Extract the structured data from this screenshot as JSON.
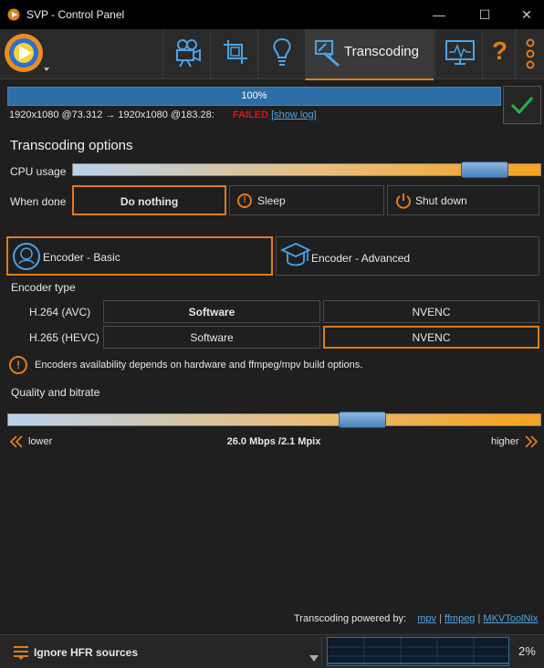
{
  "window": {
    "title": "SVP - Control Panel"
  },
  "toolbar": {
    "active_tab_label": "Transcoding",
    "help_glyph": "?"
  },
  "progress": {
    "percent_label": "100%",
    "value": 1.0
  },
  "status": {
    "text": "1920x1080 @73.312 → 1920x1080 @183.28:",
    "failed": "FAILED",
    "bracket_open": "[",
    "show_log": "show log",
    "bracket_close": "]"
  },
  "transcoding": {
    "heading": "Transcoding options",
    "cpu_usage_label": "CPU usage",
    "cpu_usage_value": 0.92,
    "when_done_label": "When done",
    "when_done": {
      "do_nothing": "Do nothing",
      "sleep": "Sleep",
      "shut_down": "Shut down"
    }
  },
  "encoder": {
    "basic_tab": "Encoder - Basic",
    "advanced_tab": "Encoder - Advanced",
    "type_label": "Encoder type",
    "h264_label": "H.264 (AVC)",
    "h265_label": "H.265 (HEVC)",
    "software": "Software",
    "nvenc": "NVENC",
    "info_text": "Encoders availability depends on hardware and ffmpeg/mpv build options."
  },
  "quality": {
    "label": "Quality and bitrate",
    "value": 0.68,
    "lower": "lower",
    "higher": "higher",
    "bitrate_text": "26.0 Mbps /2.1 Mpix"
  },
  "powered": {
    "label": "Transcoding powered by:",
    "mpv": "mpv",
    "ffmpeg": "ffmpeg",
    "mkvtoolnix": "MKVToolNix",
    "sep": "|"
  },
  "footer": {
    "profile_label": "Ignore HFR sources",
    "cpu_percent": "2%"
  },
  "colors": {
    "accent": "#e07b1c",
    "progress": "#2d6ea8",
    "failed": "#d11a1a",
    "link": "#4fa3e0",
    "ok_check": "#22b24c"
  },
  "icons": [
    "svp-logo-icon",
    "video-camera-icon",
    "crop-icon",
    "lightbulb-icon",
    "transcoding-icon",
    "monitor-icon",
    "help-icon",
    "more-icon",
    "checkmark-icon",
    "sleep-icon",
    "power-icon",
    "encoder-basic-icon",
    "encoder-advanced-icon",
    "info-icon",
    "rewind-icon",
    "fast-forward-icon",
    "menu-icon",
    "dropdown-arrow-icon"
  ]
}
